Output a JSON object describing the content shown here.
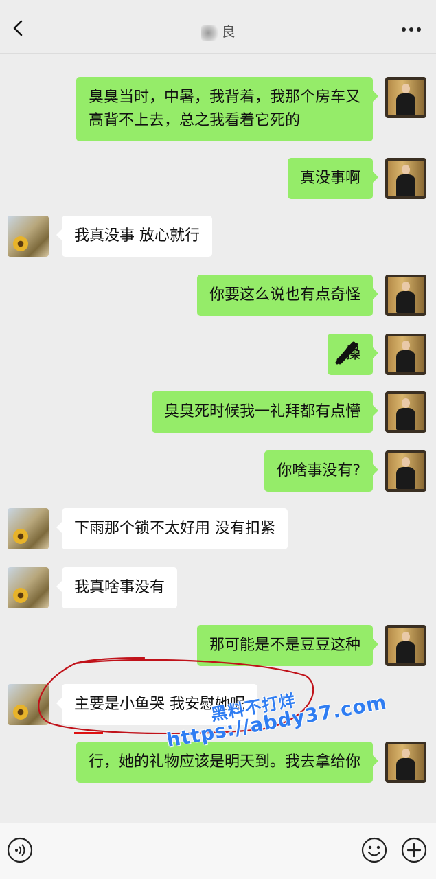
{
  "header": {
    "title": "良",
    "back_icon": "chevron-left-icon",
    "more_icon": "more-dots-icon"
  },
  "messages": [
    {
      "side": "me",
      "text": "臭臭当时，中暑，我背着，我那个房车又高背不上去，总之我看着它死的"
    },
    {
      "side": "me",
      "text": "真没事啊"
    },
    {
      "side": "other",
      "text": "我真没事 放心就行"
    },
    {
      "side": "me",
      "text": "你要这么说也有点奇怪"
    },
    {
      "side": "me",
      "text": "操"
    },
    {
      "side": "me",
      "text": "臭臭死时候我一礼拜都有点懵"
    },
    {
      "side": "me",
      "text": "你啥事没有?"
    },
    {
      "side": "other",
      "text": "下雨那个锁不太好用 没有扣紧"
    },
    {
      "side": "other",
      "text": "我真啥事没有"
    },
    {
      "side": "me",
      "text": "那可能是不是豆豆这种"
    },
    {
      "side": "other",
      "text": "主要是小鱼哭 我安慰她呢"
    },
    {
      "side": "me",
      "text": "行，她的礼物应该是明天到。我去拿给你"
    }
  ],
  "watermark": {
    "text_cn": "黑料不打烊",
    "url": "https://abdy37.com"
  },
  "input_bar": {
    "voice_icon": "voice-icon",
    "emoji_icon": "emoji-icon",
    "plus_icon": "plus-icon"
  },
  "colors": {
    "my_bubble": "#95ec69",
    "other_bubble": "#ffffff",
    "background": "#ededed",
    "annotation": "#c0121a",
    "watermark": "#2f7df2"
  }
}
